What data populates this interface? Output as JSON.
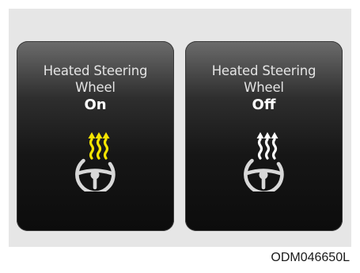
{
  "panels": [
    {
      "title_line1": "Heated Steering",
      "title_line2": "Wheel",
      "state": "On",
      "icon": "heated-steering-wheel-icon",
      "heat_color": "#f5e400"
    },
    {
      "title_line1": "Heated Steering",
      "title_line2": "Wheel",
      "state": "Off",
      "icon": "heated-steering-wheel-icon",
      "heat_color": "#ffffff"
    }
  ],
  "caption": "ODM046650L",
  "colors": {
    "background": "#e6e6e6",
    "panel": "#111111",
    "wheel": "#d8d8d8"
  }
}
